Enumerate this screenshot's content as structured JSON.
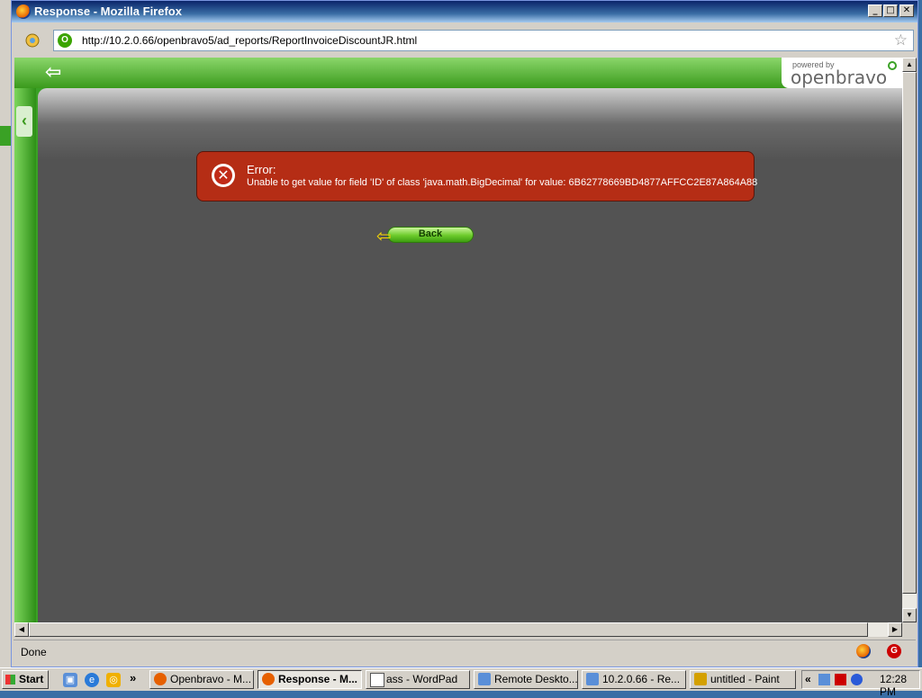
{
  "window": {
    "title": "Response - Mozilla Firefox",
    "minimize": "_",
    "maximize": "□",
    "close": "✕"
  },
  "navbar": {
    "url": "http://10.2.0.66/openbravo5/ad_reports/ReportInvoiceDiscountJR.html",
    "bookmark_icon": "☆"
  },
  "app": {
    "logo_small": "powered by",
    "logo_word": "openbravo",
    "back_arrow": "⇦",
    "collapse": "‹"
  },
  "error": {
    "title": "Error:",
    "message": "Unable to get value for field 'ID' of class 'java.math.BigDecimal' for value: 6B62778669BD4877AFFCC2E87A864A88",
    "icon": "✕"
  },
  "back_button": {
    "label": "Back",
    "arrow": "⇦"
  },
  "statusbar": {
    "text": "Done"
  },
  "taskbar": {
    "start": "Start",
    "more": "»",
    "tasks": [
      {
        "label": "Openbravo - M...",
        "color": "#e66000"
      },
      {
        "label": "Response - M...",
        "color": "#e66000"
      },
      {
        "label": "ass - WordPad",
        "color": "#ffffff"
      },
      {
        "label": "Remote Deskto...",
        "color": "#5a8fd8"
      },
      {
        "label": "10.2.0.66 - Re...",
        "color": "#5a8fd8"
      },
      {
        "label": "untitled - Paint",
        "color": "#d4a000"
      }
    ],
    "tray_more": "«",
    "clock": "12:28 PM"
  },
  "colors": {
    "accent_green": "#3aa125",
    "error_red": "#b52d15",
    "panel_gray": "#535353"
  }
}
